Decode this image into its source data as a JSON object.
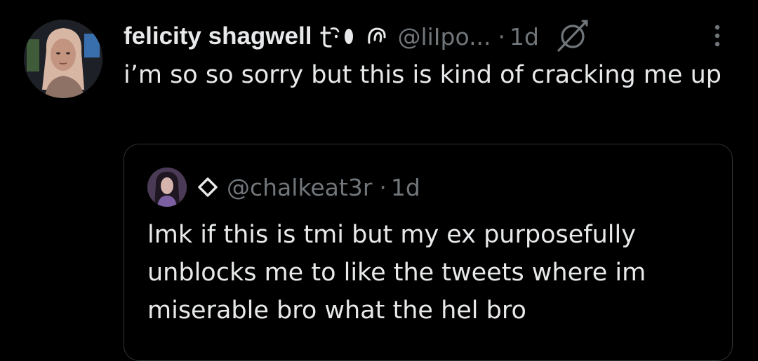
{
  "post": {
    "author": {
      "display_name": "felicity shagwell",
      "emoji_icons": [
        "hook-icon",
        "mushroom-icon"
      ],
      "handle": "@liIpo...",
      "dot": "·",
      "time": "1d"
    },
    "text": "i’m so so sorry but this is kind of cracking me up"
  },
  "quoted_post": {
    "handle": "@chalkeat3r",
    "dot": "·",
    "time": "1d",
    "text": "lmk if this is tmi but my ex purposefully unblocks me to like the tweets where im miserable bro what the hel bro"
  },
  "colors": {
    "background": "#000000",
    "text_primary": "#e7e9ea",
    "text_secondary": "#71767b",
    "border": "#2f3336"
  }
}
